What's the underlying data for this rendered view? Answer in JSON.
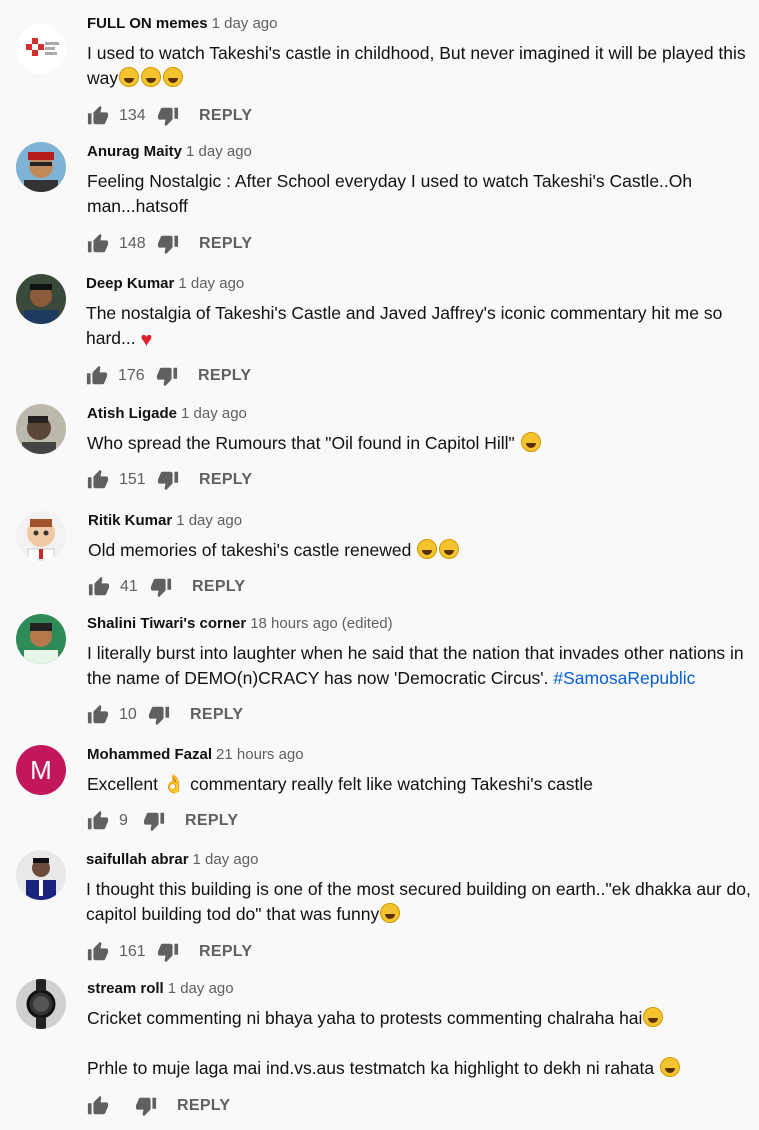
{
  "comments": [
    {
      "author": "FULL ON memes",
      "time": "1 day ago",
      "text": [
        "I used to watch Takeshi's castle in childhood, But never imagined it will be played this way"
      ],
      "likes": "134",
      "reply": "REPLY",
      "avatar": "full-on-memes-logo"
    },
    {
      "author": "Anurag Maity",
      "time": "1 day ago",
      "text": [
        "Feeling Nostalgic : After School everyday  I used to watch Takeshi's Castle..Oh man...hatsoff"
      ],
      "likes": "148",
      "reply": "REPLY"
    },
    {
      "author": "Deep Kumar",
      "time": "1 day ago",
      "text": [
        "The nostalgia of Takeshi's Castle and Javed Jaffrey's iconic commentary hit me so hard..."
      ],
      "likes": "176",
      "reply": "REPLY"
    },
    {
      "author": "Atish Ligade",
      "time": "1 day ago",
      "text": [
        "Who spread the Rumours that \"Oil found in Capitol Hill\""
      ],
      "likes": "151",
      "reply": "REPLY"
    },
    {
      "author": "Ritik Kumar",
      "time": "1 day ago",
      "text": [
        "Old memories of takeshi's castle renewed"
      ],
      "likes": "41",
      "reply": "REPLY"
    },
    {
      "author": "Shalini Tiwari's corner",
      "time": "18 hours ago",
      "edited": "(edited)",
      "text": [
        "I literally burst into laughter when he said that the nation that invades other nations in the name of DEMO(n)CRACY has now 'Democratic Circus'."
      ],
      "hashtag": "#SamosaRepublic",
      "likes": "10",
      "reply": "REPLY"
    },
    {
      "author": "Mohammed Fazal",
      "time": "21 hours ago",
      "text_a": "Excellent",
      "text_b": " commentary really felt like watching Takeshi's castle",
      "likes": "9",
      "reply": "REPLY",
      "avatar_letter": "M"
    },
    {
      "author": "saifullah abrar",
      "time": "1 day ago",
      "text": [
        "I thought this building is one of the most secured building on earth..\"ek dhakka aur do, capitol building tod do\" that was funny"
      ],
      "likes": "161",
      "reply": "REPLY"
    },
    {
      "author": "stream roll",
      "time": "1 day ago",
      "text": [
        "Cricket commenting ni bhaya yaha to protests commenting chalraha hai",
        "Prhle to muje laga mai  ind.vs.aus testmatch ka  highlight  to dekh ni rahata"
      ],
      "likes": "",
      "reply": "REPLY"
    }
  ],
  "colors": {
    "background": "#f9f9f9",
    "hashtag": "#065fd4",
    "meta": "#606060"
  }
}
